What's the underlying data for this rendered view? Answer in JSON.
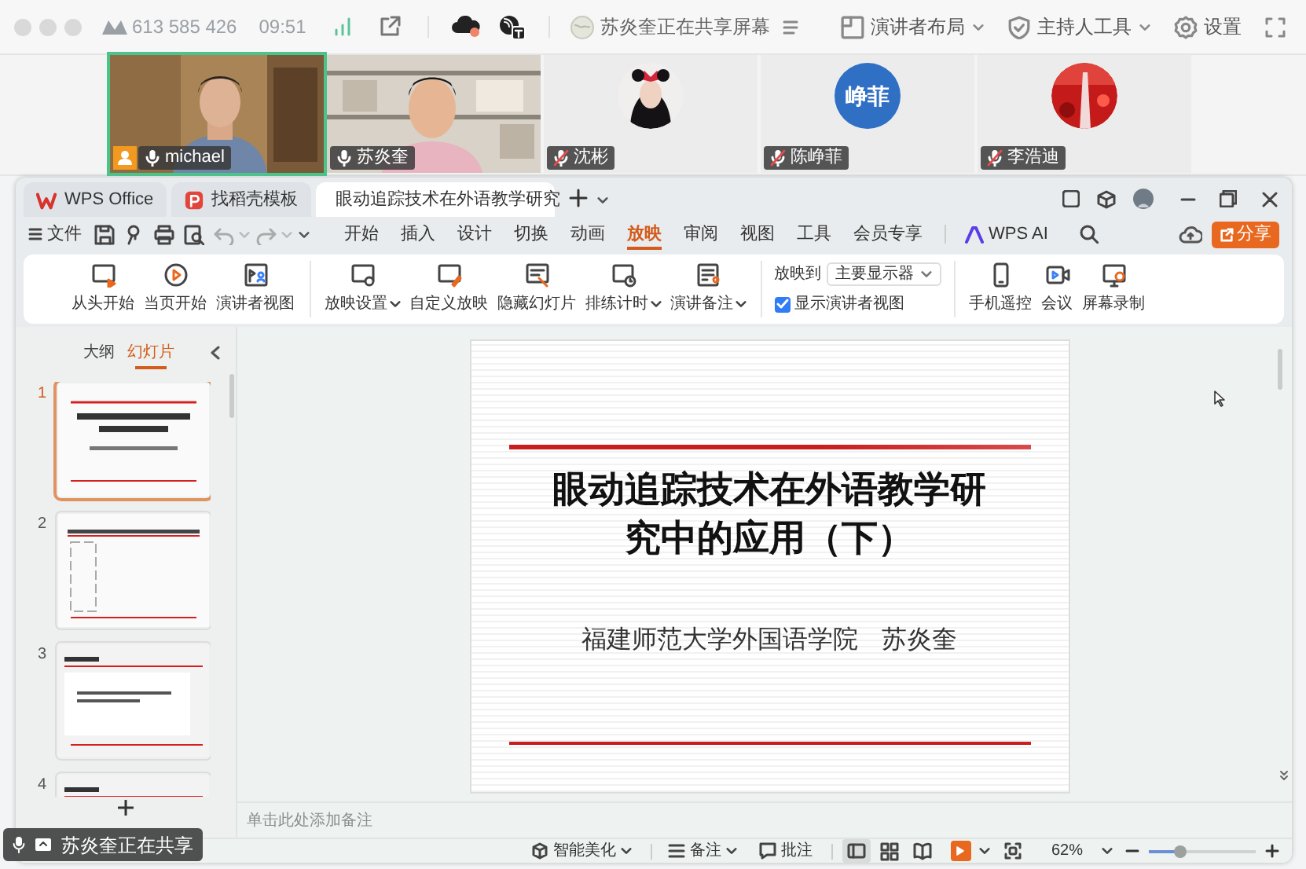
{
  "meeting_bar": {
    "meeting_id": "613 585 426",
    "time": "09:51",
    "sharing_status": "苏炎奎正在共享屏幕",
    "actions": [
      {
        "label": "演讲者布局",
        "dropdown": true
      },
      {
        "label": "主持人工具",
        "dropdown": true
      },
      {
        "label": "设置",
        "dropdown": false
      }
    ]
  },
  "participants": [
    {
      "name": "michael",
      "kind": "camera",
      "selected": true,
      "muted": false,
      "host": true
    },
    {
      "name": "苏炎奎",
      "kind": "camera",
      "selected": false,
      "muted": false,
      "host": false
    },
    {
      "name": "沈彬",
      "selected": false,
      "muted": true,
      "host": false
    },
    {
      "name": "陈峥菲",
      "kind": "initials",
      "avatar_text": "峥菲",
      "selected": false,
      "muted": true,
      "host": false
    },
    {
      "name": "李浩迪",
      "selected": false,
      "muted": true,
      "host": false
    }
  ],
  "wps": {
    "tabs": [
      {
        "label": "WPS Office",
        "selected": false
      },
      {
        "label": "找稻壳模板",
        "selected": false
      },
      {
        "label": "眼动追踪技术在外语教学研究",
        "selected": true
      }
    ],
    "file_menu": "文件",
    "menu": [
      {
        "label": "开始",
        "selected": false
      },
      {
        "label": "插入",
        "selected": false
      },
      {
        "label": "设计",
        "selected": false
      },
      {
        "label": "切换",
        "selected": false
      },
      {
        "label": "动画",
        "selected": false
      },
      {
        "label": "放映",
        "selected": true
      },
      {
        "label": "审阅",
        "selected": false
      },
      {
        "label": "视图",
        "selected": false
      },
      {
        "label": "工具",
        "selected": false
      },
      {
        "label": "会员专享",
        "selected": false
      },
      {
        "label": "WPS AI",
        "selected": false
      }
    ],
    "share_button": "分享",
    "ribbon": [
      {
        "kind": "buttons",
        "buttons": [
          {
            "label": "从头开始",
            "dropdown": false
          },
          {
            "label": "当页开始",
            "dropdown": false
          },
          {
            "label": "演讲者视图",
            "dropdown": false
          }
        ]
      },
      {
        "kind": "buttons",
        "buttons": [
          {
            "label": "放映设置",
            "dropdown": true
          },
          {
            "label": "自定义放映",
            "dropdown": false
          },
          {
            "label": "隐藏幻灯片",
            "dropdown": false
          },
          {
            "label": "排练计时",
            "dropdown": true
          },
          {
            "label": "演讲备注",
            "dropdown": true
          }
        ]
      },
      {
        "kind": "display",
        "label": "放映到",
        "value": "主要显示器",
        "checkbox": {
          "label": "显示演讲者视图",
          "checked": true
        }
      },
      {
        "kind": "buttons",
        "buttons": [
          {
            "label": "手机遥控",
            "dropdown": false
          },
          {
            "label": "会议",
            "dropdown": false
          },
          {
            "label": "屏幕录制",
            "dropdown": false
          }
        ]
      }
    ],
    "panel_tabs": [
      {
        "label": "大纲",
        "selected": false
      },
      {
        "label": "幻灯片",
        "selected": true
      }
    ],
    "slides": [
      {
        "number": "1",
        "selected": true
      },
      {
        "number": "2",
        "selected": false
      },
      {
        "number": "3",
        "selected": false
      },
      {
        "number": "4",
        "selected": false
      }
    ],
    "current_slide": {
      "title": "眼动追踪技术在外语教学研究中的应用（下）",
      "subtitle": "福建师范大学外国语学院   苏炎奎"
    },
    "notes_placeholder": "单击此处添加备注",
    "status_bar": {
      "beautify": "智能美化",
      "notes": "备注",
      "comments": "批注",
      "views": [
        {
          "selected": true
        },
        {
          "selected": false
        },
        {
          "selected": false
        }
      ],
      "zoom": "62%",
      "zoom_slider": {
        "level": 0.3
      }
    }
  },
  "share_badge": "苏炎奎正在共享"
}
